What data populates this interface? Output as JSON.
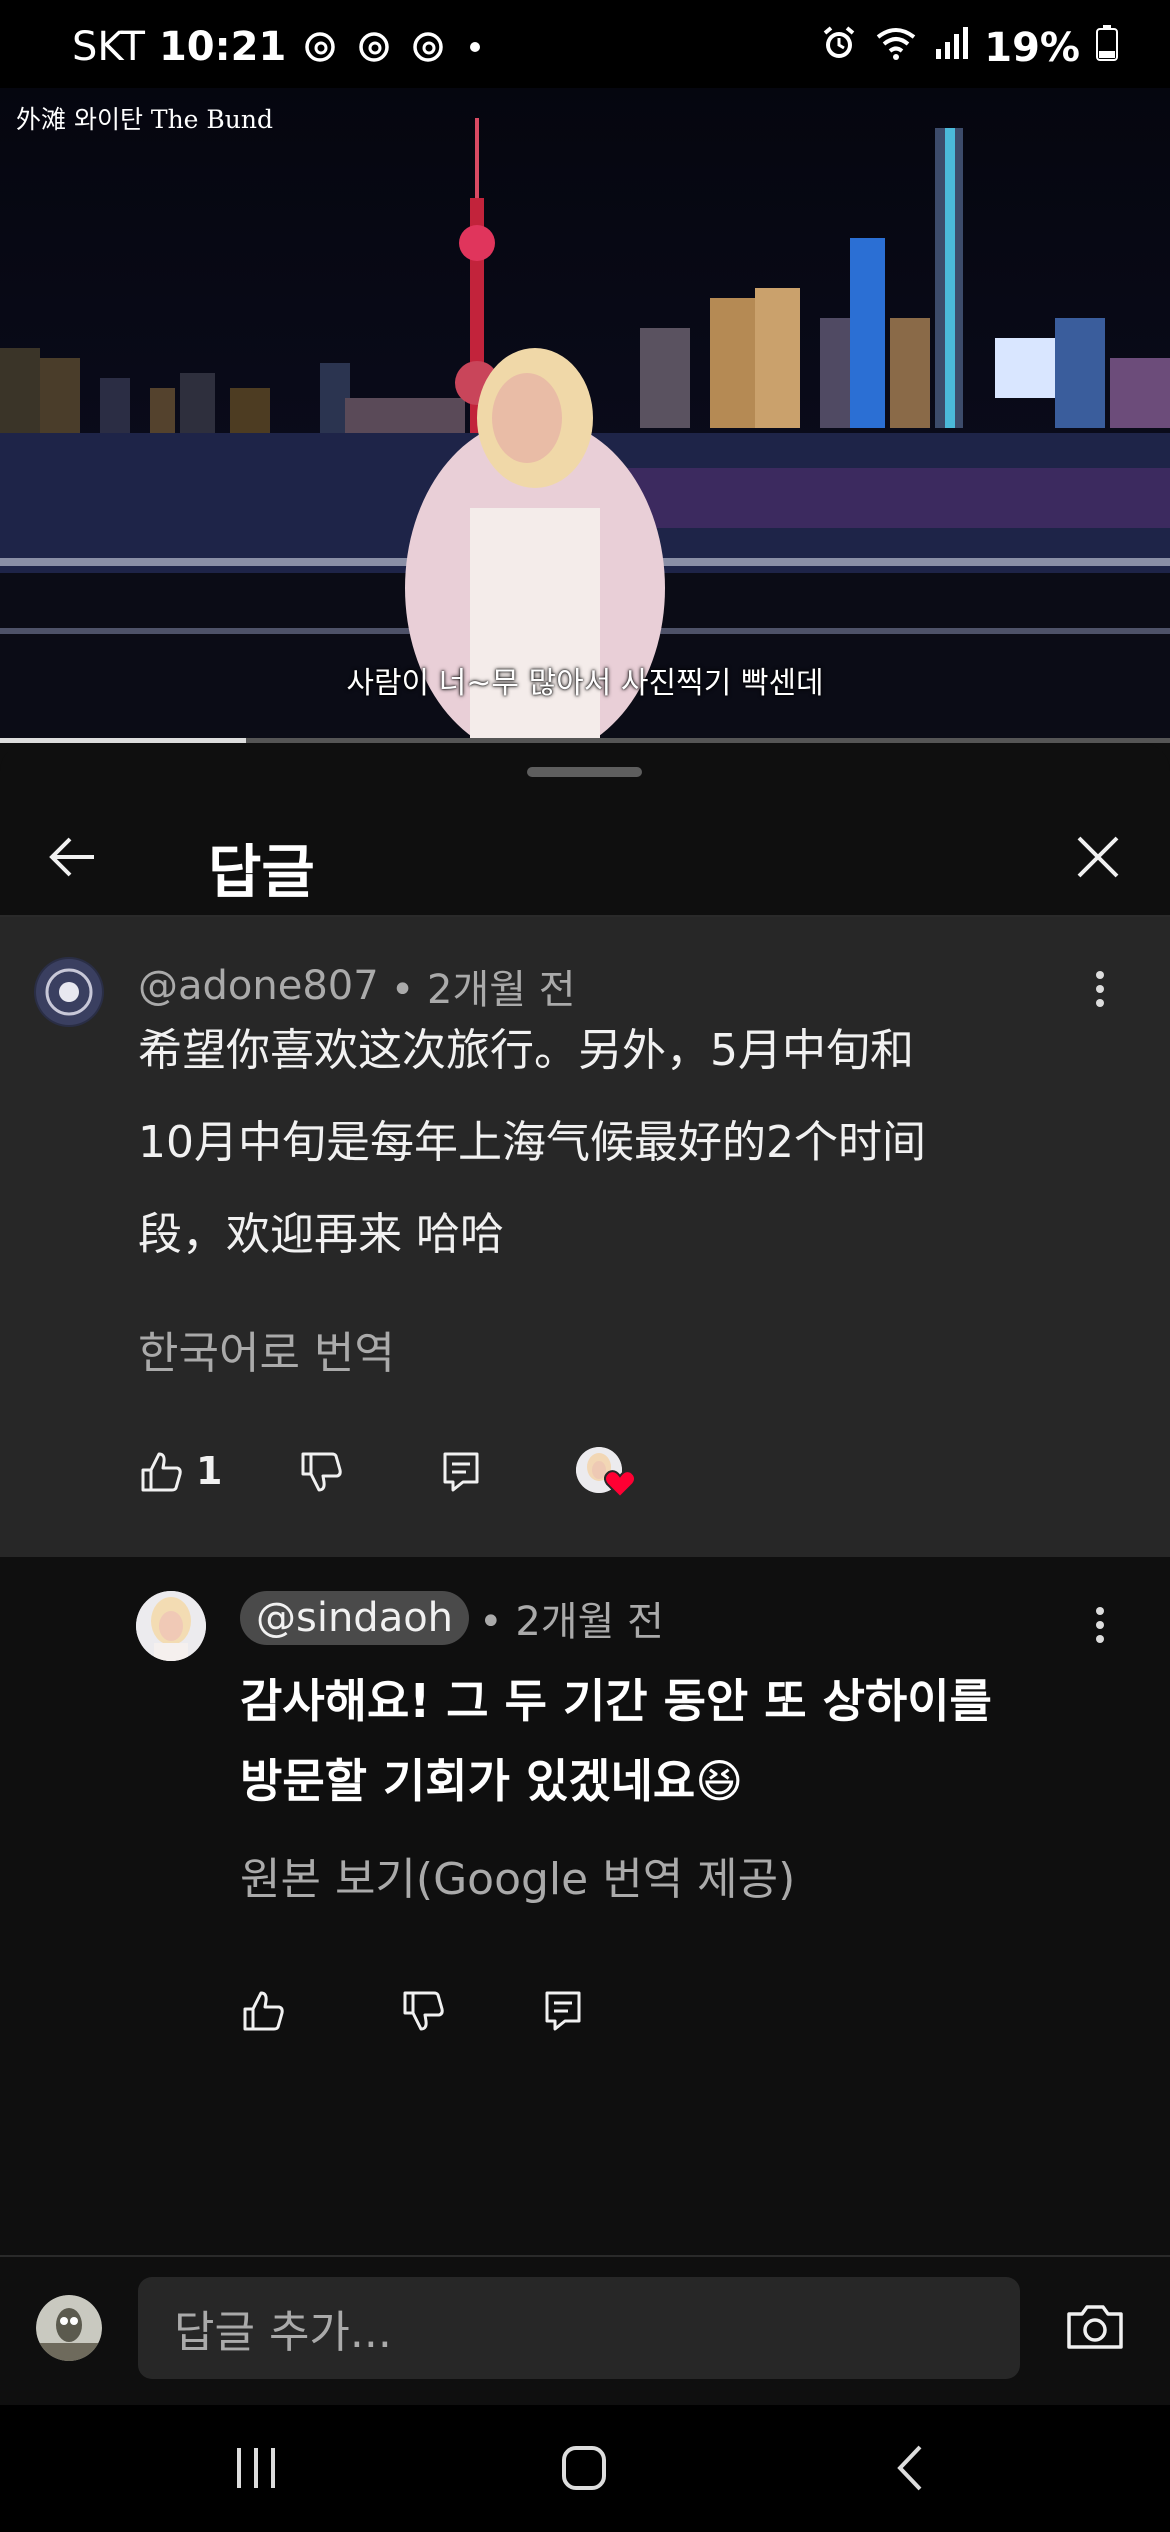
{
  "status_bar": {
    "carrier": "SKT",
    "time": "10:21",
    "battery": "19%",
    "icons": [
      "threads-icon",
      "threads-icon",
      "threads-icon",
      "dot-icon",
      "alarm-icon",
      "wifi-icon",
      "signal-icon",
      "battery-icon"
    ]
  },
  "video": {
    "caption": "外滩 와이탄 The Bund",
    "subtitle": "사람이 너~무 많아서 사진찍기 빡센데",
    "progress": 0.21
  },
  "sheet": {
    "title": "답글"
  },
  "parent_comment": {
    "handle": "@adone807",
    "age": "• 2개월 전",
    "lines": [
      "希望你喜欢这次旅行。另外，5月中旬和",
      "10月中旬是每年上海气候最好的2个时间",
      "段，欢迎再来 哈哈"
    ],
    "translate_label": "한국어로 번역",
    "like_count": "1"
  },
  "reply": {
    "handle": "@sindaoh",
    "age": "• 2개월 전",
    "lines": [
      "감사해요! 그 두 기간 동안 또 상하이를",
      "방문할 기회가 있겠네요😆"
    ],
    "translate_label": "원본 보기(Google 번역 제공)"
  },
  "input": {
    "placeholder": "답글 추가..."
  },
  "colors": {
    "background": "#0f0f0f",
    "highlighted_comment": "#272727",
    "secondary_text": "#aaaaaa",
    "heart": "#ff0033"
  }
}
